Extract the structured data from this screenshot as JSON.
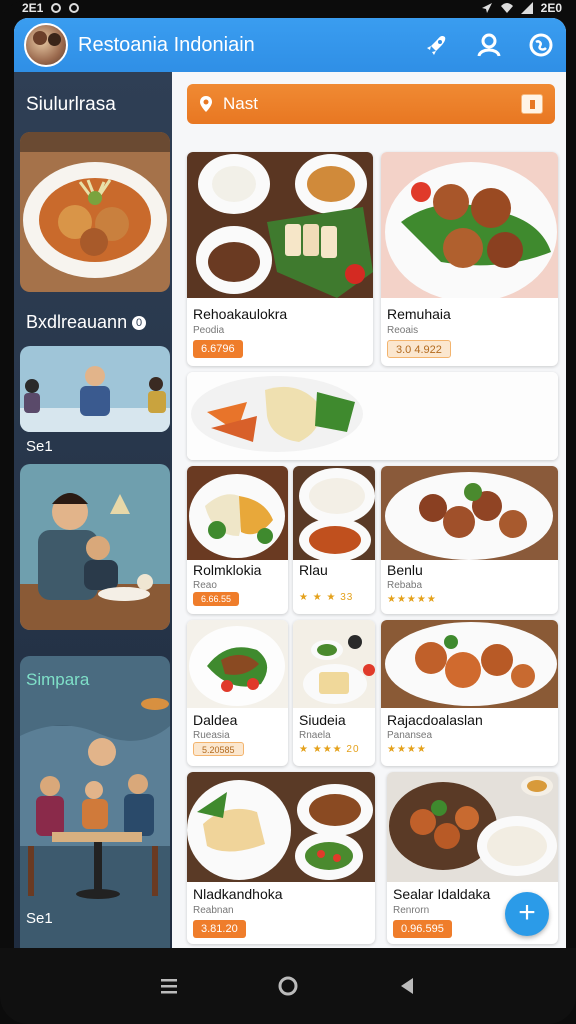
{
  "status_bar": {
    "time": "2E1",
    "battery": "2E0"
  },
  "app": {
    "title": "Restoania Indoniain"
  },
  "icons": {
    "appbar": [
      "rocket-icon",
      "profile-icon",
      "globe-icon"
    ],
    "search": "location-pin-icon",
    "nav": [
      "menu-icon",
      "home-icon",
      "back-icon"
    ]
  },
  "sidebar": {
    "sections": [
      {
        "title": "Siulurlrasa"
      },
      {
        "title": "Bxdlreauann",
        "badge": "0",
        "caption": "Se1"
      },
      {
        "title": "Simpara",
        "caption": "Se1"
      }
    ]
  },
  "search": {
    "placeholder": "Nast"
  },
  "cards": [
    {
      "name": "Rehoakaulokra",
      "sub": "Peodia",
      "price": "6.6796"
    },
    {
      "name": "Remuhaia",
      "sub": "Reoais",
      "price": "3.0 4.922"
    },
    {
      "name": "Rolmklokia",
      "sub": "Reao",
      "price": "6.66.55",
      "rating": "★★★★★"
    },
    {
      "name": "Rlau",
      "sub": "",
      "rating": "★ ★ ★ 33"
    },
    {
      "name": "Benlu",
      "sub": "Rebaba",
      "rating": "★★★★★"
    },
    {
      "name": "Daldea",
      "sub": "Rueasia",
      "price": "5.20585"
    },
    {
      "name": "Siudeia",
      "sub": "Rnaela",
      "rating": "★ ★★★ 20"
    },
    {
      "name": "Rajacdoalaslan",
      "sub": "Panansea",
      "rating": "★★★★"
    },
    {
      "name": "Nladkandhoka",
      "sub": "Reabnan",
      "price": "3.81.20"
    },
    {
      "name": "Sealar Idaldaka",
      "sub": "Renrorn",
      "price": "0.96.595"
    }
  ],
  "colors": {
    "primary": "#2f8fe6",
    "accent": "#e87722",
    "sidebar": "#2f3f55",
    "fab": "#2b9be8"
  }
}
